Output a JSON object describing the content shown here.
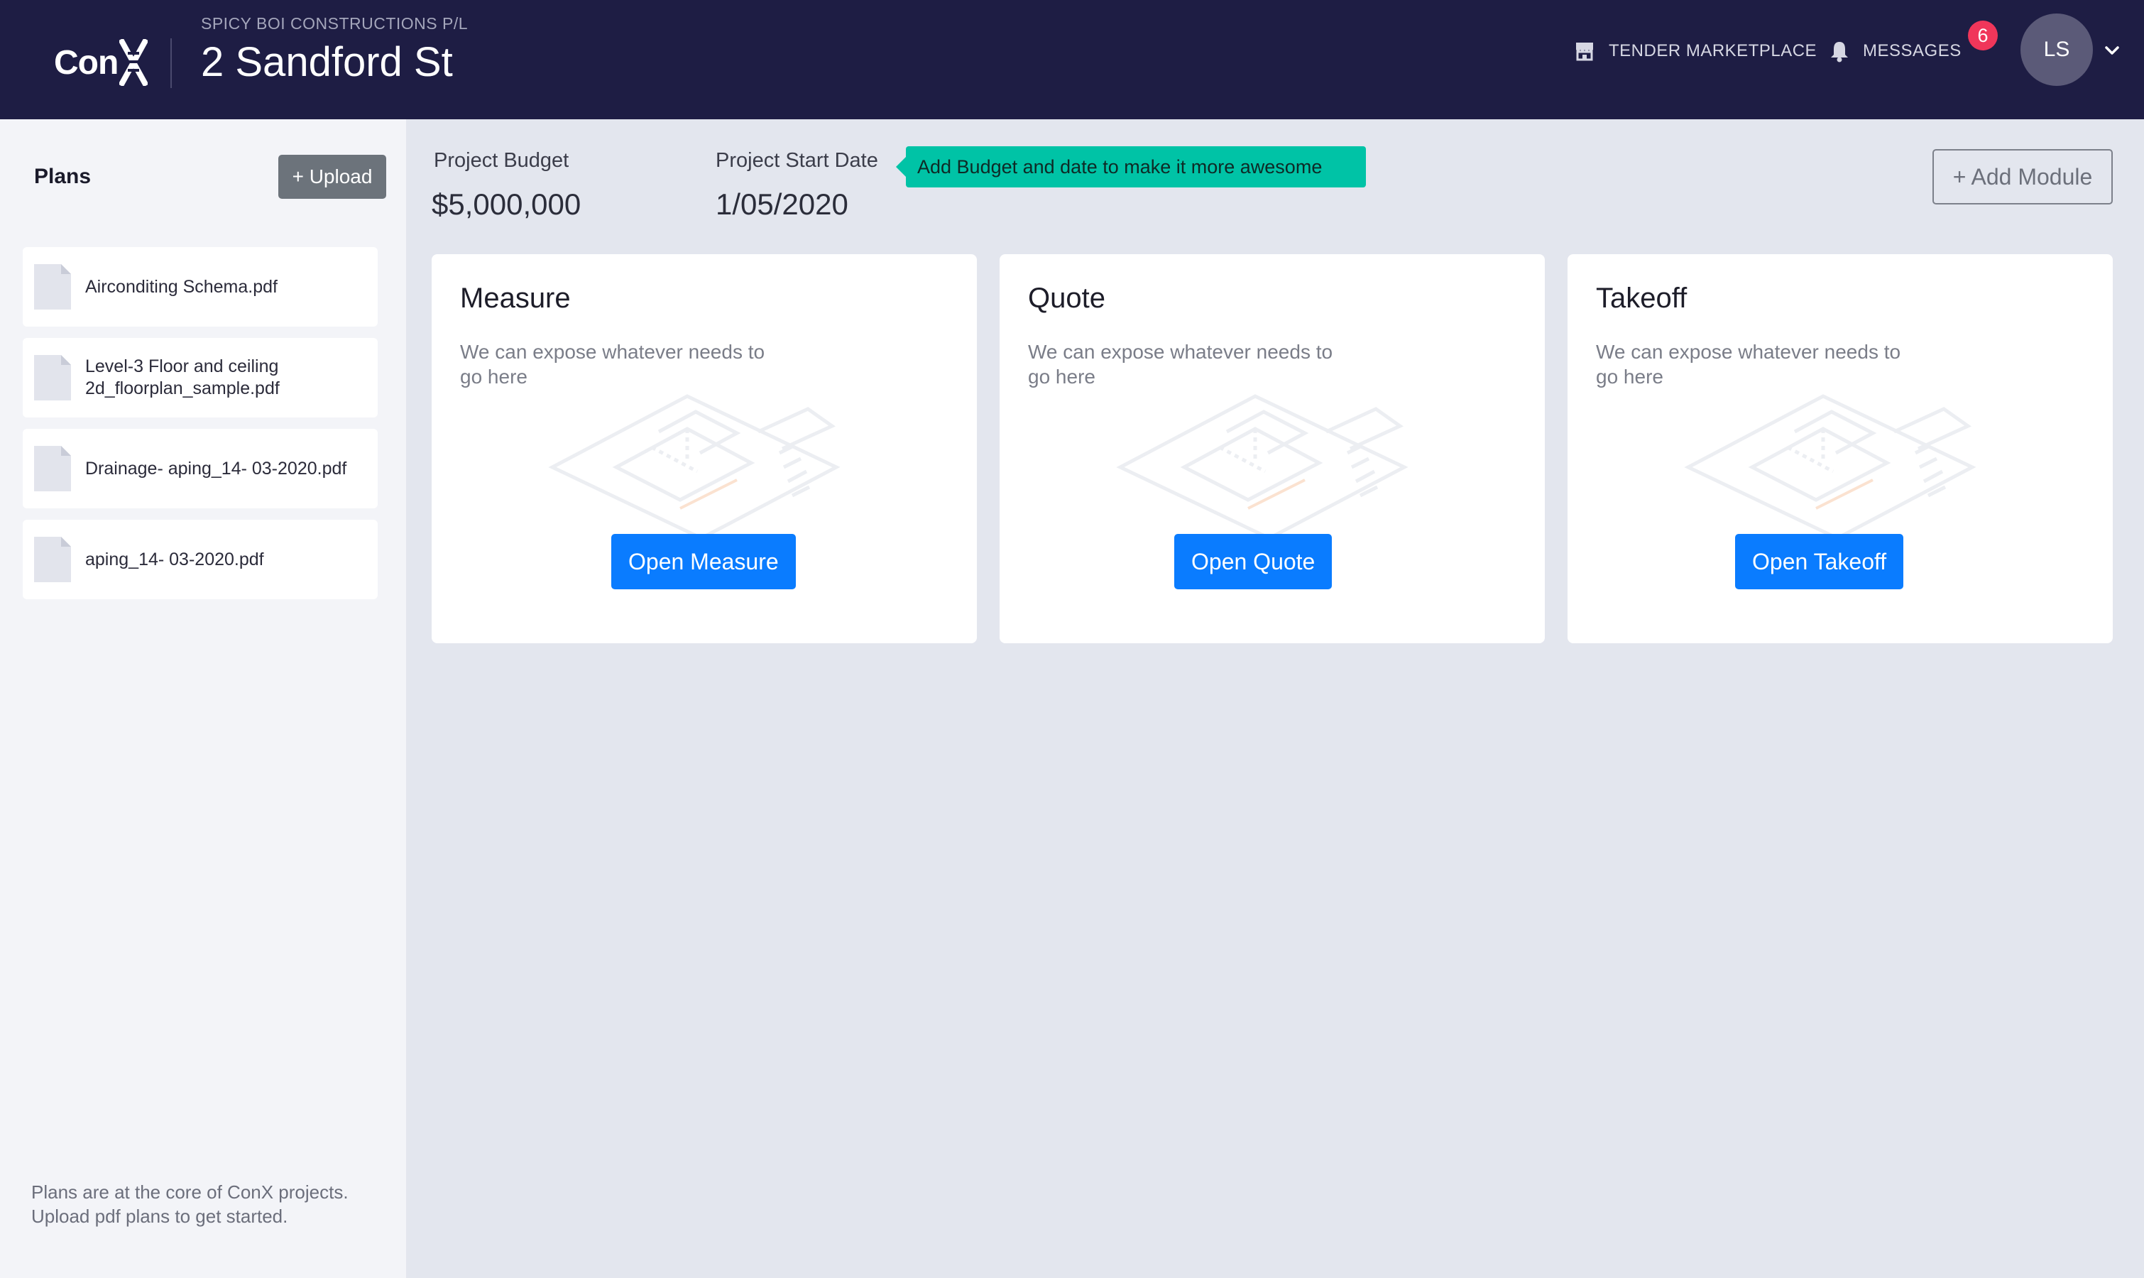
{
  "header": {
    "logo_text": "Con",
    "company": "SPICY BOI CONSTRUCTIONS P/L",
    "project_title": "2 Sandford St",
    "nav": {
      "tender_label": "TENDER MARKETPLACE",
      "messages_label": "MESSAGES",
      "messages_count": "6"
    },
    "user_initials": "LS"
  },
  "sidebar": {
    "title": "Plans",
    "upload_label": "+ Upload",
    "files": [
      {
        "name": "Airconditing Schema.pdf"
      },
      {
        "name": "Level-3 Floor and ceiling 2d_floorplan_sample.pdf"
      },
      {
        "name": "Drainage- aping_14- 03-2020.pdf"
      },
      {
        "name": "aping_14- 03-2020.pdf"
      }
    ],
    "footer": "Plans are at the core of ConX projects. Upload pdf plans to get started."
  },
  "main": {
    "budget_label": "Project Budget",
    "budget_value": "$5,000,000",
    "start_label": "Project Start Date",
    "start_value": "1/05/2020",
    "tip": "Add Budget and date to make it more awesome",
    "add_module_label": "+ Add Module",
    "modules": [
      {
        "title": "Measure",
        "desc": "We can expose whatever needs to go here",
        "button": "Open Measure"
      },
      {
        "title": "Quote",
        "desc": "We can expose whatever needs to go here",
        "button": "Open Quote"
      },
      {
        "title": "Takeoff",
        "desc": "We can expose whatever needs to go here",
        "button": "Open Takeoff"
      }
    ]
  },
  "colors": {
    "header_bg": "#1e1d44",
    "accent_blue": "#0a7cff",
    "tip_teal": "#00c3a6",
    "badge_red": "#f0365a"
  }
}
